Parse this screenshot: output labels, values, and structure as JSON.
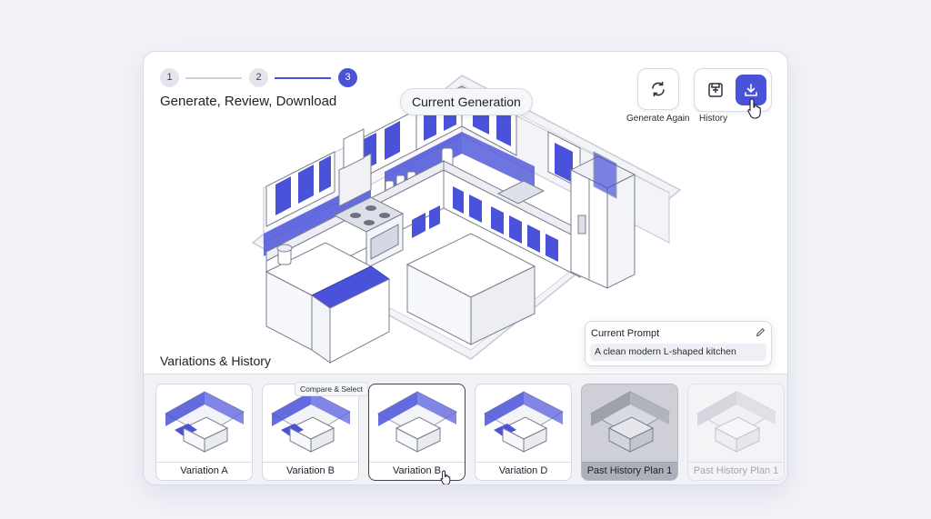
{
  "stepper": {
    "steps": [
      "1",
      "2",
      "3"
    ],
    "active_step": 3
  },
  "header": {
    "title": "Generate, Review, Download",
    "current_label": "Current Generation"
  },
  "actions": {
    "regenerate_label": "Generate Again",
    "history_label": "History",
    "download_icon": "download-icon",
    "save_icon": "save-icon",
    "refresh_icon": "refresh-icon"
  },
  "variations": {
    "title": "Variations & History",
    "tooltip": "Compare & Select",
    "items": [
      {
        "label": "Variation A",
        "state": "normal"
      },
      {
        "label": "Variation B",
        "state": "normal"
      },
      {
        "label": "Variation B",
        "state": "selected"
      },
      {
        "label": "Variation D",
        "state": "normal"
      },
      {
        "label": "Past History Plan 1",
        "state": "history"
      },
      {
        "label": "Past History Plan 1",
        "state": "faded"
      }
    ]
  },
  "prompt": {
    "label": "Current Prompt",
    "value": "A clean modern L-shaped kitchen"
  },
  "colors": {
    "accent": "#4a52d9",
    "background": "#f2f3f8",
    "card": "#ffffff"
  }
}
